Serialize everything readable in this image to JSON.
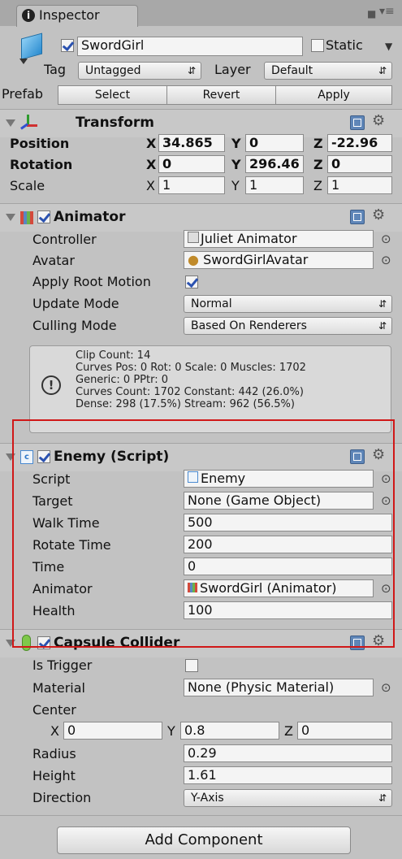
{
  "tab": {
    "label": "Inspector"
  },
  "object": {
    "name": "SwordGirl",
    "active": true,
    "static_label": "Static",
    "static": false,
    "tag_label": "Tag",
    "tag_value": "Untagged",
    "layer_label": "Layer",
    "layer_value": "Default"
  },
  "prefab": {
    "label": "Prefab",
    "select": "Select",
    "revert": "Revert",
    "apply": "Apply"
  },
  "transform": {
    "title": "Transform",
    "position_label": "Position",
    "position": {
      "x": "34.865",
      "y": "0",
      "z": "-22.96"
    },
    "rotation_label": "Rotation",
    "rotation": {
      "x": "0",
      "y": "296.46",
      "z": "0"
    },
    "scale_label": "Scale",
    "scale": {
      "x": "1",
      "y": "1",
      "z": "1"
    },
    "axis": {
      "x": "X",
      "y": "Y",
      "z": "Z"
    }
  },
  "animator": {
    "title": "Animator",
    "controller_label": "Controller",
    "controller_value": "Juliet Animator",
    "avatar_label": "Avatar",
    "avatar_value": "SwordGirlAvatar",
    "root_motion_label": "Apply Root Motion",
    "root_motion": true,
    "update_label": "Update Mode",
    "update_value": "Normal",
    "culling_label": "Culling Mode",
    "culling_value": "Based On Renderers",
    "info": [
      "Clip Count: 14",
      "Curves Pos: 0 Rot: 0 Scale: 0 Muscles: 1702",
      "Generic: 0 PPtr: 0",
      "Curves Count: 1702 Constant: 442 (26.0%)",
      "Dense: 298 (17.5%) Stream: 962 (56.5%)"
    ]
  },
  "enemy": {
    "title": "Enemy (Script)",
    "script_label": "Script",
    "script_value": "Enemy",
    "target_label": "Target",
    "target_value": "None (Game Object)",
    "walk_label": "Walk Time",
    "walk_value": "500",
    "rotate_label": "Rotate Time",
    "rotate_value": "200",
    "time_label": "Time",
    "time_value": "0",
    "animator_label": "Animator",
    "animator_value": "SwordGirl (Animator)",
    "health_label": "Health",
    "health_value": "100"
  },
  "capsule": {
    "title": "Capsule Collider",
    "trigger_label": "Is Trigger",
    "trigger": false,
    "material_label": "Material",
    "material_value": "None (Physic Material)",
    "center_label": "Center",
    "center": {
      "x": "0",
      "y": "0.8",
      "z": "0"
    },
    "radius_label": "Radius",
    "radius_value": "0.29",
    "height_label": "Height",
    "height_value": "1.61",
    "direction_label": "Direction",
    "direction_value": "Y-Axis"
  },
  "add_component": "Add Component",
  "colors": {
    "highlight": "#d01818",
    "panel": "#c2c2c2",
    "checkmark": "#2b52b0"
  }
}
